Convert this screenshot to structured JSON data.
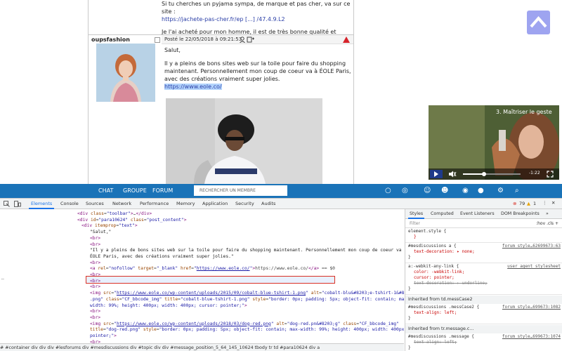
{
  "post_prev": {
    "line1": "Si tu cherches un pyjama sympa, de marque et pas cher, va sur ce site :",
    "link": "https://jachete-pas-cher.fr/ep [...] /47.4.9.L2",
    "line2": "Je l'ai acheté pour mon homme, il est de très bonne qualité et taille très bien."
  },
  "post": {
    "author": "oupsfashion",
    "date": "Posté le 22/05/2018 à 09:21:53",
    "greeting": "Salut,",
    "body": "Il y a pleins de bons sites web sur la toile pour faire du shopping maintenant. Personnellement mon coup de coeur va à ÉOLE Paris, avec des créations vraiment super jolies.",
    "link": "https://www.eole.co/"
  },
  "video": {
    "title": "3. Maîtriser le geste",
    "time": "-1:22",
    "progress": 0.37
  },
  "navbar": {
    "chat": "CHAT",
    "groupe": "GROUPE",
    "forum": "FORUM",
    "search_placeholder": "RECHERCHER UN MEMBRE"
  },
  "devtools": {
    "tabs": [
      "Elements",
      "Console",
      "Sources",
      "Network",
      "Performance",
      "Memory",
      "Application",
      "Security",
      "Audits"
    ],
    "errors": "79",
    "warnings": "1",
    "code_lines": [
      {
        "indent": 110,
        "html": "<span class='tag'>&lt;div</span> <span class='attr'>class</span>=<span class='val'>\"toolbar\"</span><span class='tag'>&gt;</span>…<span class='tag'>&lt;/div&gt;</span>"
      },
      {
        "indent": 110,
        "html": "<span class='tag'>&lt;div</span> <span class='attr'>id</span>=<span class='val'>\"para10624\"</span> <span class='attr'>class</span>=<span class='val'>\"post_content\"</span><span class='tag'>&gt;</span>"
      },
      {
        "indent": 116,
        "html": "<span class='tag'>&lt;div</span> <span class='attr'>itemprop</span>=<span class='val'>\"text\"</span><span class='tag'>&gt;</span>"
      },
      {
        "indent": 128,
        "html": "<span class='txt'>\"Salut,\"</span>"
      },
      {
        "indent": 128,
        "html": "<span class='tag'>&lt;br&gt;</span>"
      },
      {
        "indent": 128,
        "html": "<span class='tag'>&lt;br&gt;</span>"
      },
      {
        "indent": 128,
        "html": "<span class='txt'>\"Il y a pleins de bons sites web sur la toile pour faire du shopping maintenant. Personnellement mon coup de coeur va à</span>"
      },
      {
        "indent": 128,
        "html": "<span class='txt'>ÉOLE Paris, avec des créations vraiment super jolies.\"</span>"
      },
      {
        "indent": 128,
        "html": "<span class='tag'>&lt;br&gt;</span>"
      },
      {
        "indent": 128,
        "html": "<span class='tag'>&lt;a</span> <span class='attr'>rel</span>=<span class='val'>\"nofollow\"</span> <span class='attr'>target</span>=<span class='val'>\"_blank\"</span> <span class='attr'>href</span>=<span class='val'>\"<u>https://www.eole.co/</u>\"</span><span class='tag'>&gt;</span>https://www.eole.co/<span class='tag'>&lt;/a&gt;</span> == $0"
      },
      {
        "indent": 128,
        "html": "<span class='tag'>&lt;br&gt;</span>"
      },
      {
        "indent": 128,
        "html": "<span class='tag'>&lt;br&gt;</span>"
      },
      {
        "indent": 128,
        "html": "<span class='tag'>&lt;br&gt;</span>"
      },
      {
        "indent": 128,
        "html": "<span class='tag'>&lt;img</span> <span class='attr'>src</span>=<span class='val'>\"<u>https://www.eole.co/wp-content/uploads/2015/09/cobalt-blue-tshirt-1.png</u>\"</span> <span class='attr'>alt</span>=<span class='val'>\"cobalt-blu&amp;#8203;e-tshirt-1&amp;#8203;</span>"
      },
      {
        "indent": 128,
        "html": "<span class='val'>.png\"</span> <span class='attr'>class</span>=<span class='val'>\"CF_bbcode_img\"</span> <span class='attr'>title</span>=<span class='val'>\"cobalt-blue-tshirt-1.png\"</span> <span class='attr'>style</span>=<span class='val'>\"border: 0px; padding: 5px; object-fit: contain; max-</span>"
      },
      {
        "indent": 128,
        "html": "<span class='val'>width: 99%; height: 400px; width: 400px; cursor: pointer;\"</span><span class='tag'>&gt;</span>"
      },
      {
        "indent": 128,
        "html": "<span class='tag'>&lt;br&gt;</span>"
      },
      {
        "indent": 128,
        "html": "<span class='tag'>&lt;br&gt;</span>"
      },
      {
        "indent": 128,
        "html": "<span class='tag'>&lt;img</span> <span class='attr'>src</span>=<span class='val'>\"<u>https://www.eole.co/wp-content/uploads/2018/03/dog-red.png</u>\"</span> <span class='attr'>alt</span>=<span class='val'>\"dog-red.pn&amp;#8203;g\"</span> <span class='attr'>class</span>=<span class='val'>\"CF_bbcode_img\"</span>"
      },
      {
        "indent": 128,
        "html": "<span class='attr'>title</span>=<span class='val'>\"dog-red.png\"</span> <span class='attr'>style</span>=<span class='val'>\"border: 0px; padding: 5px; object-fit: contain; max-width: 99%; height: 400px; width: 400px; cursor:</span>"
      },
      {
        "indent": 128,
        "html": "<span class='val'>pointer;\"</span><span class='tag'>&gt;</span>"
      },
      {
        "indent": 128,
        "html": "<span class='tag'>&lt;br&gt;</span>"
      }
    ],
    "breadcrumbs": "# #container   div   div   div   #lesforums   div   #mesdiscussions   div   #topic   div   div   #message_position_5_64_145_10624   tbody   tr   td   #para10624   div   a",
    "styles_tabs": [
      "Styles",
      "Computed",
      "Event Listeners",
      "DOM Breakpoints"
    ],
    "filter": "Filter",
    "filter_right": ":hov  .cls  +",
    "rules": [
      {
        "sel": "element.style {",
        "body": "}",
        "src": ""
      },
      {
        "sel": "#mesdiscussions a {",
        "body": "text-decoration: ▸ none;",
        "src": "forum_style…62699673:63"
      },
      {
        "sel": "a:-webkit-any-link {",
        "body": "color: -webkit-link; cursor: pointer;",
        "strike": "text-decoration: ▸ underline;",
        "src": "user agent stylesheet"
      },
      {
        "sel": "Inherited from td.messCase2",
        "inh": true
      },
      {
        "sel": "#mesdiscussions .messCase2 {",
        "body": "text-align: left;",
        "src": "forum_style…699673:1082"
      },
      {
        "sel": "Inherited from tr.message.c…",
        "inh": true
      },
      {
        "sel": "#mesdiscussions .message {",
        "strike": "text-align: left;",
        "src": "forum_style…699673:1074"
      }
    ]
  }
}
